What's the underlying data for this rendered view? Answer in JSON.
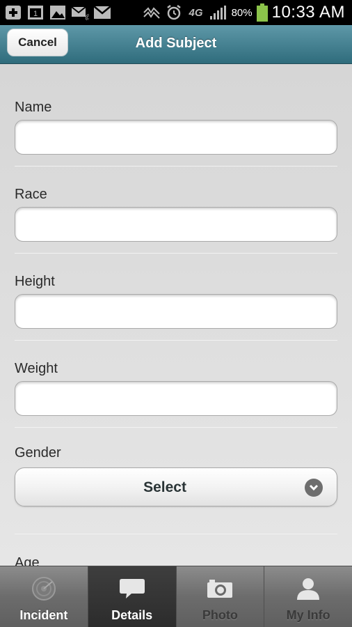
{
  "status_bar": {
    "icons": [
      "add-icon",
      "calendar-icon",
      "image-icon",
      "voicemail-icon",
      "gmail-icon",
      "no-signal-icon",
      "alarm-icon",
      "4g-icon",
      "signal-icon",
      "battery-icon"
    ],
    "network": "4G",
    "battery": "80%",
    "time": "10:33 AM",
    "battery_color": "#8bc34a"
  },
  "header": {
    "cancel_label": "Cancel",
    "title": "Add Subject",
    "color": "#3f7d8d"
  },
  "form": {
    "fields": [
      {
        "label": "Name",
        "value": "",
        "placeholder": ""
      },
      {
        "label": "Race",
        "value": "",
        "placeholder": ""
      },
      {
        "label": "Height",
        "value": "",
        "placeholder": ""
      },
      {
        "label": "Weight",
        "value": "",
        "placeholder": ""
      }
    ],
    "gender": {
      "label": "Gender",
      "selected": "Select"
    },
    "age_label": "Age"
  },
  "tabs": [
    {
      "label": "Incident",
      "icon": "radar-icon",
      "active": false
    },
    {
      "label": "Details",
      "icon": "speech-bubble-icon",
      "active": true
    },
    {
      "label": "Photo",
      "icon": "camera-icon",
      "active": false
    },
    {
      "label": "My Info",
      "icon": "person-icon",
      "active": false
    }
  ]
}
